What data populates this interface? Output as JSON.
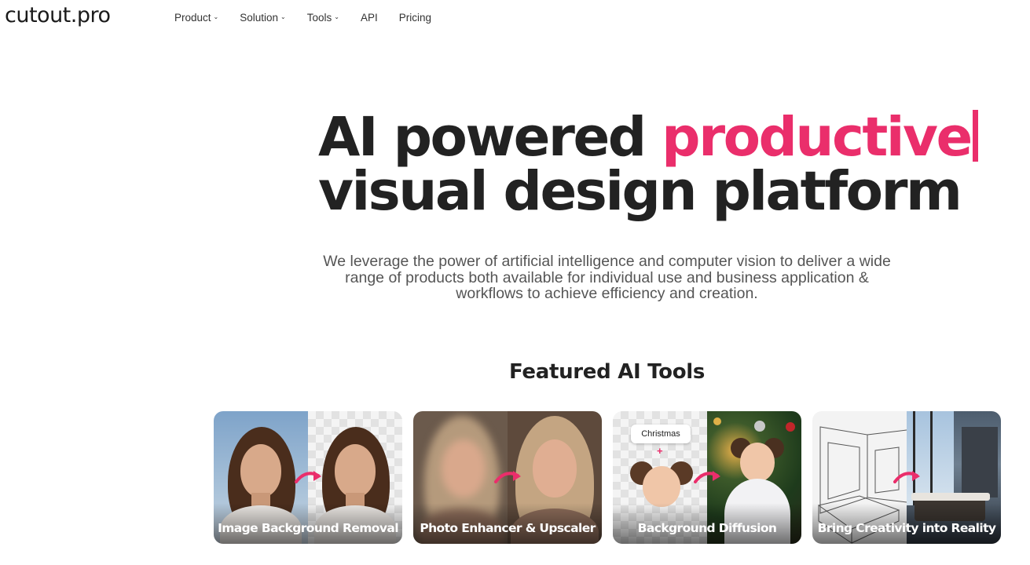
{
  "brand": {
    "logo_text": "cutout.pro"
  },
  "nav": {
    "items": [
      {
        "label": "Product",
        "has_dropdown": true
      },
      {
        "label": "Solution",
        "has_dropdown": true
      },
      {
        "label": "Tools",
        "has_dropdown": true
      },
      {
        "label": "API",
        "has_dropdown": false
      },
      {
        "label": "Pricing",
        "has_dropdown": false
      }
    ],
    "chevron_icon": "chevron-down-icon"
  },
  "hero": {
    "line1_prefix": "AI powered ",
    "line1_accent": "productive",
    "line2": "visual design platform"
  },
  "subtitle": "We leverage the power of artificial intelligence and computer vision to deliver a wide range of products both available for individual use and business application & workflows to achieve efficiency and creation.",
  "featured": {
    "title": "Featured AI Tools",
    "cards": [
      {
        "label": "Image Background Removal"
      },
      {
        "label": "Photo Enhancer & Upscaler"
      },
      {
        "label": "Background Diffusion",
        "chip": "Christmas",
        "plus": "+"
      },
      {
        "label": "Bring Creativity into Reality"
      }
    ]
  },
  "colors": {
    "accent": "#ea2e6b",
    "text_dark": "#222222",
    "text_muted": "#555555",
    "background": "#ffffff"
  }
}
